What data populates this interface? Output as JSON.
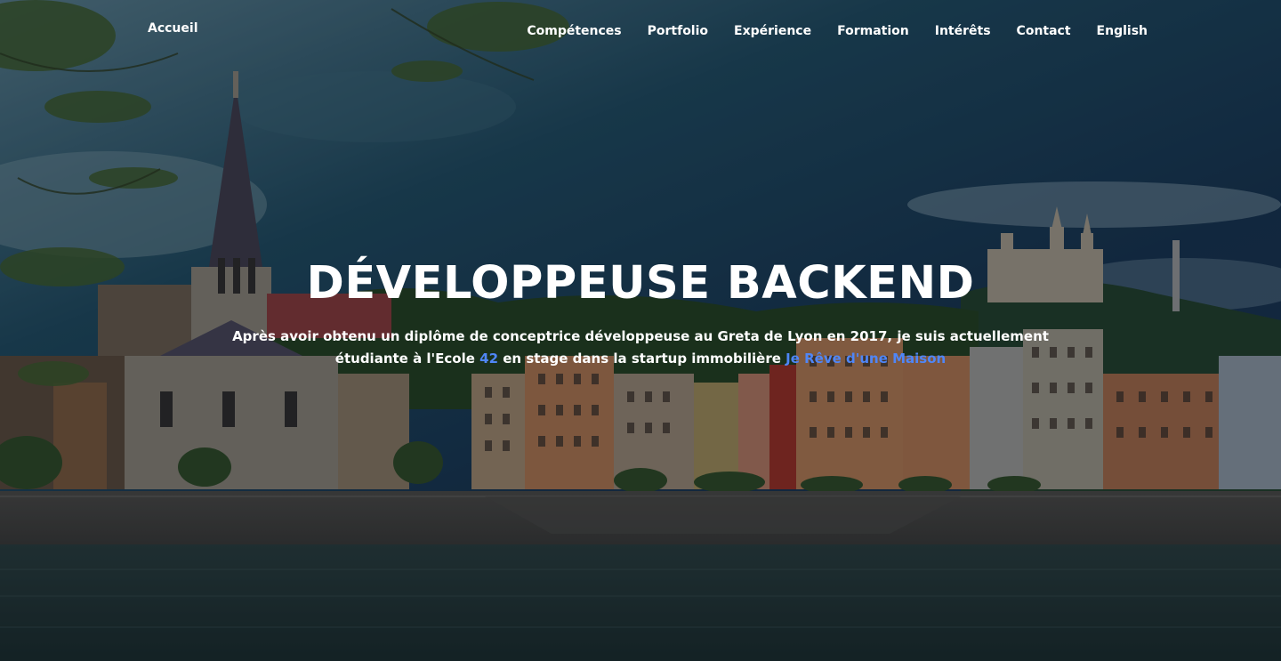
{
  "nav": {
    "home": "Accueil",
    "items": [
      {
        "label": "Compétences"
      },
      {
        "label": "Portfolio"
      },
      {
        "label": "Expérience"
      },
      {
        "label": "Formation"
      },
      {
        "label": "Intérêts"
      },
      {
        "label": "Contact"
      },
      {
        "label": "English"
      }
    ]
  },
  "hero": {
    "title": "DÉVELOPPEUSE BACKEND",
    "desc_part1": "Après avoir obtenu un diplôme de conceptrice développeuse au Greta de Lyon en 2017, je suis actuellement étudiante à l'Ecole",
    "link_school": "42",
    "desc_part2": "en stage dans la startup immobilière",
    "link_startup": "Je Rêve d'une Maison"
  },
  "colors": {
    "accent": "#4f86f7",
    "text": "#ffffff",
    "overlay": "#060e16"
  }
}
